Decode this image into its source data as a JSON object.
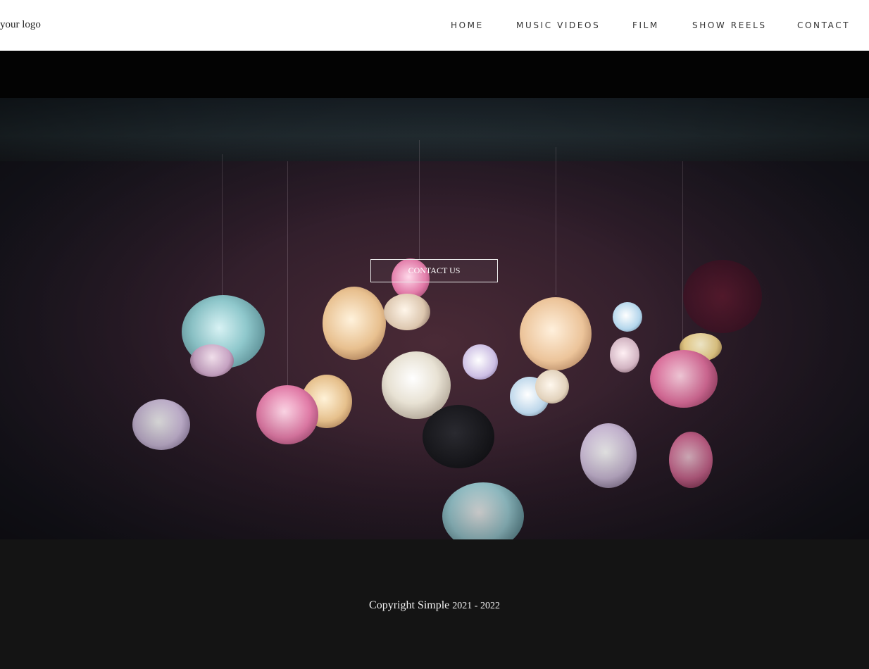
{
  "header": {
    "logo": "your logo",
    "nav": [
      {
        "label": "HOME"
      },
      {
        "label": "MUSIC VIDEOS"
      },
      {
        "label": "FILM"
      },
      {
        "label": "SHOW REELS"
      },
      {
        "label": "CONTACT"
      }
    ]
  },
  "hero": {
    "button_label": "CONTACT US"
  },
  "footer": {
    "copyright": "Copyright Simple",
    "years": "2021 - 2022"
  }
}
